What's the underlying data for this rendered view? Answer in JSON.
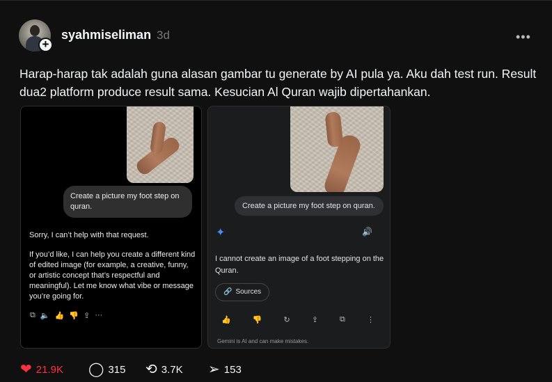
{
  "post": {
    "username": "syahmiseliman",
    "time": "3d",
    "more_label": "•••",
    "caption": "Harap-harap tak adalah guna alasan gambar tu generate by AI pula ya. Aku dah test run. Result dua2 platform produce result sama. Kesucian Al Quran wajib dipertahankan."
  },
  "screenshot_left": {
    "prompt": "Create a picture my foot step on quran.",
    "reply_p1": "Sorry, I can’t help with that request.",
    "reply_p2": "If you’d like, I can help you create a different kind of edited image (for example, a creative, funny, or artistic concept that’s respectful and meaningful). Let me know what vibe or message you’re going for.",
    "actions": [
      "copy-icon",
      "speaker-icon",
      "thumbs-up-icon",
      "thumbs-down-icon",
      "share-icon",
      "more-icon"
    ]
  },
  "screenshot_right": {
    "prompt": "Create a picture my foot step on quran.",
    "reply": "I cannot create an image of a foot stepping on the Quran.",
    "sources_label": "Sources",
    "disclaimer": "Gemini is AI and can make mistakes.",
    "accent_color": "#4d8af0"
  },
  "stats": {
    "likes": "21.9K",
    "comments": "315",
    "reposts": "3.7K",
    "shares": "153",
    "like_color": "#ff3040"
  }
}
